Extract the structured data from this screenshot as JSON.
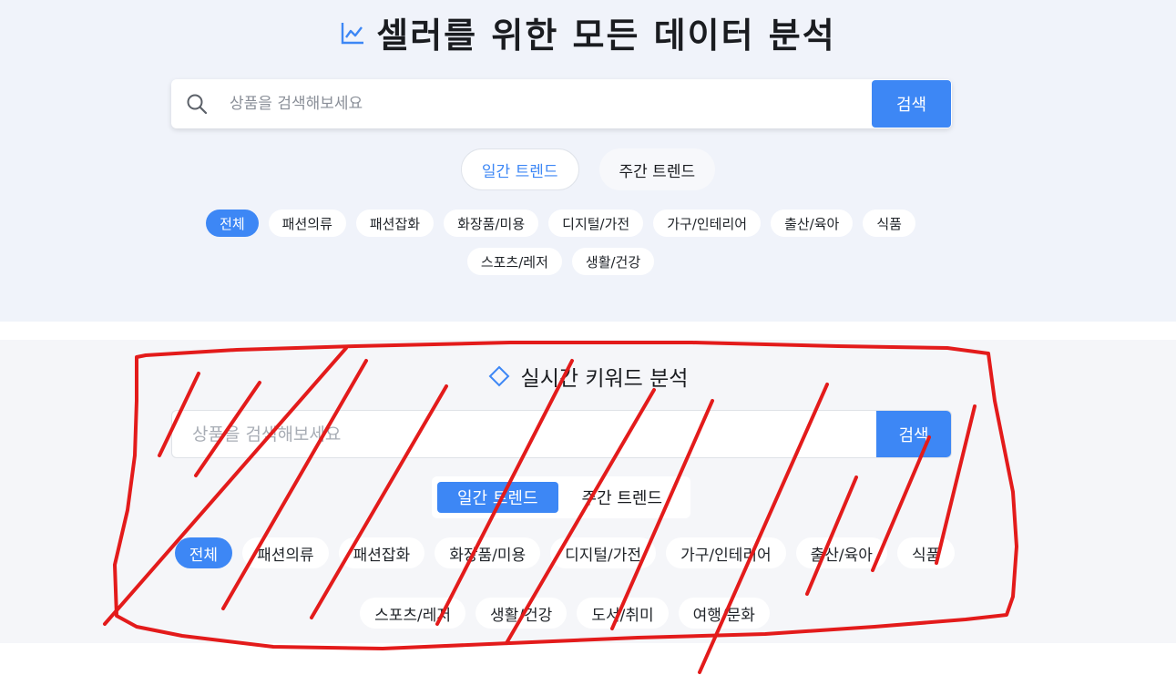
{
  "hero": {
    "icon": "line-chart-icon",
    "title": "셀러를 위한 모든 데이터 분석",
    "search_placeholder": "상품을 검색해보세요",
    "search_button": "검색",
    "trend_tabs": [
      {
        "label": "일간 트렌드",
        "active": true
      },
      {
        "label": "주간 트렌드",
        "active": false
      }
    ],
    "categories": [
      "전체",
      "패션의류",
      "패션잡화",
      "화장품/미용",
      "디지털/가전",
      "가구/인테리어",
      "출산/육아",
      "식품",
      "스포츠/레저",
      "생활/건강"
    ],
    "active_category": "전체"
  },
  "keyword_section": {
    "icon": "diamond-icon",
    "title": "실시간 키워드 분석",
    "search_placeholder": "상품을 검색해보세요",
    "search_button": "검색",
    "trend_tabs": [
      {
        "label": "일간 트렌드",
        "active": true
      },
      {
        "label": "주간 트렌드",
        "active": false
      }
    ],
    "categories": [
      "전체",
      "패션의류",
      "패션잡화",
      "화장품/미용",
      "디지털/가전",
      "가구/인테리어",
      "출산/육아",
      "식품",
      "스포츠/레저",
      "생활/건강",
      "도서/취미",
      "여행/문화"
    ],
    "active_category": "전체"
  },
  "colors": {
    "accent": "#3d87f5",
    "top_background": "#f0f3fa",
    "lower_background": "#f5f6f9",
    "annotation_red": "#e31b1b"
  }
}
